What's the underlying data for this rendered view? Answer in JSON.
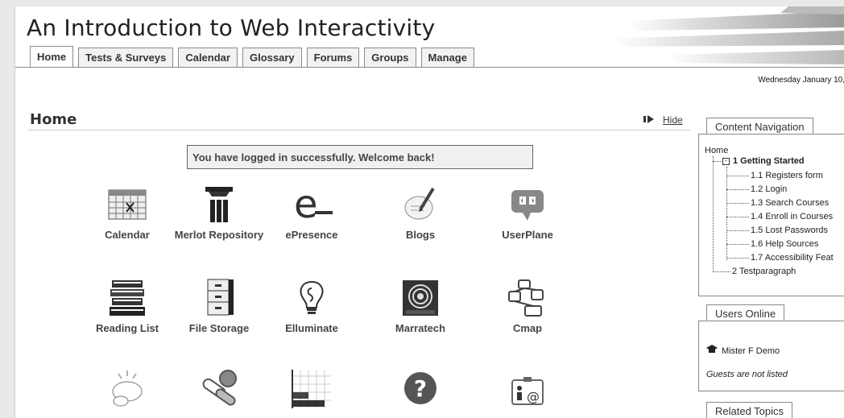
{
  "header": {
    "title": "An Introduction to Web Interactivity",
    "date": "Wednesday January 10,"
  },
  "tabs": [
    "Home",
    "Tests & Surveys",
    "Calendar",
    "Glossary",
    "Forums",
    "Groups",
    "Manage"
  ],
  "active_tab": "Home",
  "page": {
    "heading": "Home",
    "hide_label": "Hide",
    "welcome": "You have logged in successfully. Welcome back!"
  },
  "tools": [
    {
      "label": "Calendar",
      "icon": "calendar-icon"
    },
    {
      "label": "Merlot Repository",
      "icon": "merlot-icon"
    },
    {
      "label": "ePresence",
      "icon": "epresence-icon"
    },
    {
      "label": "Blogs",
      "icon": "blogs-icon"
    },
    {
      "label": "UserPlane",
      "icon": "userplane-icon"
    },
    {
      "label": "Reading List",
      "icon": "books-icon"
    },
    {
      "label": "File Storage",
      "icon": "file-cabinet-icon"
    },
    {
      "label": "Elluminate",
      "icon": "lightbulb-icon"
    },
    {
      "label": "Marratech",
      "icon": "marratech-icon"
    },
    {
      "label": "Cmap",
      "icon": "cmap-icon"
    },
    {
      "label": "",
      "icon": "chat-icon"
    },
    {
      "label": "",
      "icon": "pills-icon"
    },
    {
      "label": "",
      "icon": "bar-chart-icon"
    },
    {
      "label": "",
      "icon": "question-icon"
    },
    {
      "label": "",
      "icon": "email-contact-icon"
    }
  ],
  "content_navigation": {
    "title": "Content Navigation",
    "root": "Home",
    "section": "1 Getting Started",
    "items": [
      "1.1 Registers form",
      "1.2 Login",
      "1.3 Search Courses",
      "1.4 Enroll in Courses",
      "1.5 Lost Passwords",
      "1.6 Help Sources",
      "1.7 Accessibility Feat"
    ],
    "section2": "2 Testparagraph"
  },
  "users_online": {
    "title": "Users Online",
    "user": "Mister F Demo",
    "guests": "Guests are not listed"
  },
  "related_topics": {
    "title": "Related Topics"
  }
}
